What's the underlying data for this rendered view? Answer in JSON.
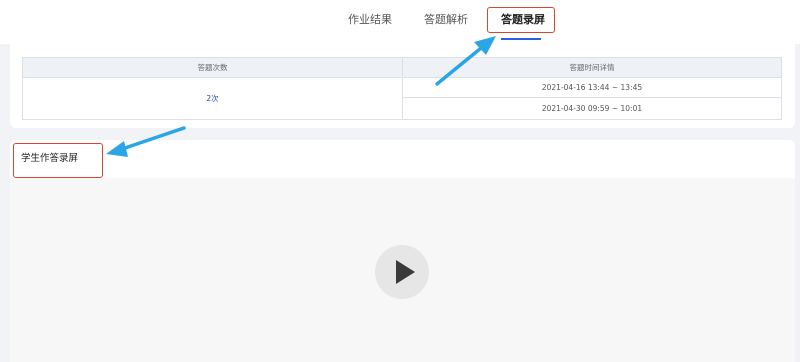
{
  "tabs": [
    {
      "label": "作业结果"
    },
    {
      "label": "答题解析"
    },
    {
      "label": "答题录屏",
      "active": true
    }
  ],
  "attempts_table": {
    "headers": [
      "答题次数",
      "答题时间详情"
    ],
    "count": "2次",
    "times": [
      "2021-04-16 13:44 ~ 13:45",
      "2021-04-30 09:59 ~ 10:01"
    ]
  },
  "recording": {
    "title": "学生作答录屏",
    "play_icon": "play-icon"
  },
  "colors": {
    "highlight_box": "#d6452d",
    "annotation_arrow": "#2aa6e6",
    "active_tab_underline": "#2f5ee0",
    "count_text": "#2a4e9b"
  }
}
